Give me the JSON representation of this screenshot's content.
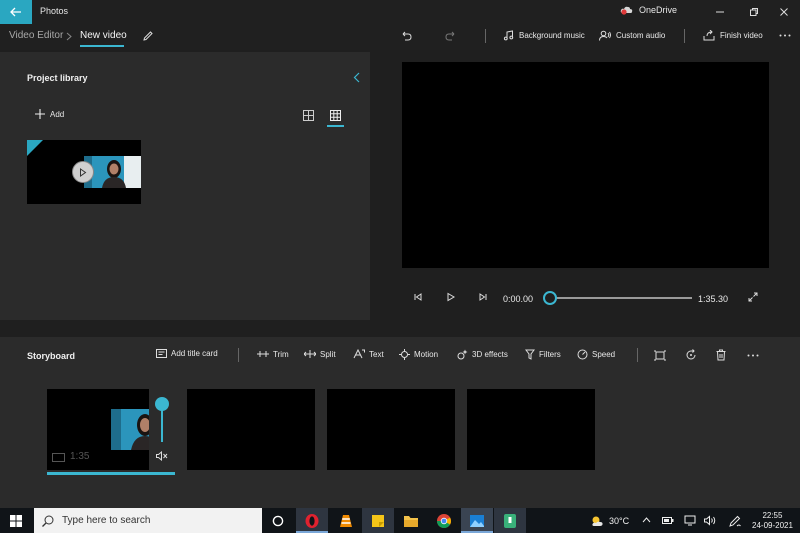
{
  "window": {
    "app_title": "Photos",
    "onedrive_label": "OneDrive"
  },
  "commandbar": {
    "breadcrumb_root": "Video Editor",
    "breadcrumb_current": "New video",
    "background_music": "Background music",
    "custom_audio": "Custom audio",
    "finish_video": "Finish video"
  },
  "library": {
    "title": "Project library",
    "add_label": "Add"
  },
  "player": {
    "current_time": "0:00.00",
    "total_time": "1:35.30",
    "progress": 0
  },
  "storyboard": {
    "title": "Storyboard",
    "tools": {
      "add_title_card": "Add title card",
      "trim": "Trim",
      "split": "Split",
      "text": "Text",
      "motion": "Motion",
      "effects_3d": "3D effects",
      "filters": "Filters",
      "speed": "Speed"
    },
    "clips": [
      {
        "duration": "1:35"
      }
    ]
  },
  "taskbar": {
    "search_placeholder": "Type here to search",
    "temperature": "30°C",
    "time": "22:55",
    "date": "24-09-2021"
  },
  "colors": {
    "accent": "#2aa7c1",
    "background": "#1f1f1f",
    "panel": "#2b2b2b"
  }
}
